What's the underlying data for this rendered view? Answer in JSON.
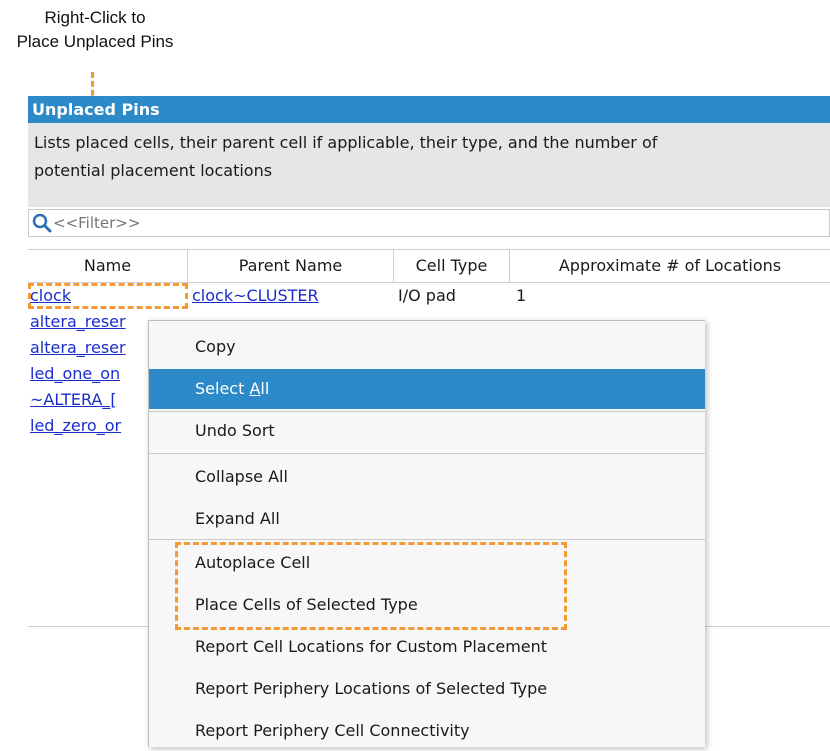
{
  "callout": {
    "line1": "Right-Click to",
    "line2": "Place Unplaced Pins"
  },
  "panel": {
    "title": "Unplaced Pins",
    "description_line1": "Lists placed cells, their parent cell if applicable, their type, and the number of",
    "description_line2": "potential placement locations",
    "filter_placeholder": "<<Filter>>"
  },
  "table": {
    "columns": [
      "Name",
      "Parent Name",
      "Cell Type",
      "Approximate # of Locations"
    ],
    "rows": [
      {
        "name": "clock",
        "parent": "clock~CLUSTER",
        "type": "I/O pad",
        "locations": "1"
      },
      {
        "name": "altera_reser",
        "parent": "",
        "type": "",
        "locations": ""
      },
      {
        "name": "altera_reser",
        "parent": "",
        "type": "",
        "locations": ""
      },
      {
        "name": "led_one_on",
        "parent": "",
        "type": "",
        "locations": ""
      },
      {
        "name": "~ALTERA_[",
        "parent": "",
        "type": "",
        "locations": ""
      },
      {
        "name": "led_zero_or",
        "parent": "",
        "type": "",
        "locations": ""
      }
    ]
  },
  "context_menu": {
    "copy": "Copy",
    "select_all_prefix": "Select ",
    "select_all_mnemonic": "A",
    "select_all_suffix": "ll",
    "undo_sort": "Undo Sort",
    "collapse_all": "Collapse All",
    "expand_all": "Expand All",
    "autoplace_cell": "Autoplace Cell",
    "place_cells_selected_type": "Place Cells of Selected Type",
    "report_cell_locations": "Report Cell Locations for Custom Placement",
    "report_periphery_locations": "Report Periphery Locations of Selected Type",
    "report_periphery_connectivity": "Report Periphery Cell Connectivity"
  },
  "colors": {
    "accent": "#2c8ac8",
    "callout": "#f39a34",
    "link": "#1a2dcc"
  },
  "icons": {
    "filter": "search-icon"
  }
}
